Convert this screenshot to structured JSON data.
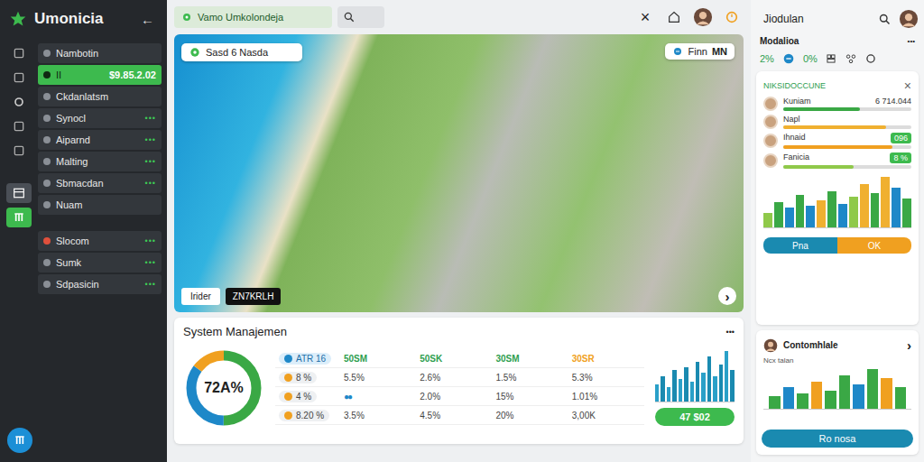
{
  "sidebar": {
    "logo": "Umonicia",
    "back": "←",
    "rail": [
      {
        "selected": false
      },
      {
        "selected": false
      },
      {
        "selected": false
      },
      {
        "selected": false
      },
      {
        "selected": false
      },
      {
        "selected": true
      },
      {
        "selected": false
      }
    ],
    "items": [
      {
        "label": "Nambotin",
        "value": "",
        "more": "",
        "selected": false
      },
      {
        "label": "II",
        "value": "$9.85.2.02",
        "more": "",
        "selected": true
      },
      {
        "label": "Ckdanlatsm",
        "value": "",
        "more": "",
        "selected": false
      },
      {
        "label": "Synocl",
        "value": "",
        "more": "•••",
        "selected": false
      },
      {
        "label": "Aiparnd",
        "value": "",
        "more": "•••",
        "selected": false
      },
      {
        "label": "Malting",
        "value": "",
        "more": "•••",
        "selected": false
      },
      {
        "label": "Sbmacdan",
        "value": "",
        "more": "•••",
        "selected": false
      },
      {
        "label": "Nuam",
        "value": "",
        "more": "",
        "selected": false
      }
    ],
    "items2": [
      {
        "label": "Slocom",
        "more": "•••"
      },
      {
        "label": "Sumk",
        "more": "•••"
      },
      {
        "label": "Sdpasicin",
        "more": "•••"
      }
    ]
  },
  "topbar": {
    "search": "Vamo Umkolondeja",
    "close": "×"
  },
  "map": {
    "location": "Sasd 6 Nasda",
    "toggle": "Finn",
    "toggle_value": "MN",
    "btn1": "Irider",
    "btn2": "ZN7KRLH",
    "next": "›"
  },
  "system": {
    "title": "System Manajemen",
    "more": "•••",
    "donut_label": "72A%",
    "donut": [
      {
        "level": 0.5,
        "color": "#3aa845"
      },
      {
        "level": 0.35,
        "color": "#1e88c8"
      },
      {
        "level": 0.15,
        "color": "#f0a020"
      }
    ],
    "columns": [
      {
        "label": "ATR 16",
        "color": "#1e88c8"
      },
      {
        "label": "50SM",
        "color": "#2e9e4f"
      },
      {
        "label": "50SK",
        "color": "#2e9e4f"
      },
      {
        "label": "30SM",
        "color": "#2e9e4f"
      },
      {
        "label": "30SR",
        "color": "#f0a020"
      }
    ],
    "rows": [
      {
        "color": "#f0a020",
        "cells": [
          "8 %",
          "5.5%",
          "2.6%",
          "1.5%",
          "5.3%"
        ]
      },
      {
        "color": "#f0a020",
        "cells": [
          "4 %",
          "●●",
          "2.0%",
          "15%",
          "1.01%"
        ]
      },
      {
        "color": "#f0a020",
        "cells": [
          "8.20 %",
          "3.5%",
          "4.5%",
          "20%",
          "3,00K"
        ]
      }
    ],
    "chart": [
      30,
      45,
      25,
      55,
      40,
      60,
      35,
      70,
      50,
      80,
      45,
      65,
      90,
      55
    ],
    "button": "47 $02"
  },
  "right": {
    "title": "Jiodulan",
    "section": "Modalioa",
    "more": "•••",
    "stat1": "2%",
    "stat2": "0%",
    "card_title": "NIKSIDOCCUNE",
    "close": "×",
    "people": [
      {
        "name": "Kuniam",
        "value": "6 714.044",
        "badge": "",
        "level": 0.6,
        "color": "#3aa845"
      },
      {
        "name": "Napl",
        "value": "",
        "badge": "",
        "level": 0.8,
        "color": "#f0b030"
      },
      {
        "name": "Ihnaid",
        "value": "",
        "badge": "096",
        "level": 0.85,
        "color": "#f0a020"
      },
      {
        "name": "Fanicia",
        "value": "",
        "badge": "8 %",
        "level": 0.55,
        "color": "#8fc94a"
      }
    ],
    "bars": [
      {
        "value": 20,
        "color": "#8fc94a"
      },
      {
        "value": 35,
        "color": "#3aa845"
      },
      {
        "value": 28,
        "color": "#1e88c8"
      },
      {
        "value": 45,
        "color": "#3aa845"
      },
      {
        "value": 30,
        "color": "#1e88c8"
      },
      {
        "value": 38,
        "color": "#f0b030"
      },
      {
        "value": 50,
        "color": "#3aa845"
      },
      {
        "value": 32,
        "color": "#1e88c8"
      },
      {
        "value": 42,
        "color": "#8fc94a"
      },
      {
        "value": 60,
        "color": "#f0b030"
      },
      {
        "value": 48,
        "color": "#3aa845"
      },
      {
        "value": 70,
        "color": "#f0b030"
      },
      {
        "value": 55,
        "color": "#1e88c8"
      },
      {
        "value": 40,
        "color": "#3aa845"
      }
    ],
    "btn1": "Pna",
    "btn2": "OK",
    "card2_title": "Contomhlale",
    "card2_arrow": "›",
    "card2_label": "Ncx talan",
    "card2_bars": [
      {
        "value": 20,
        "color": "#3aa845"
      },
      {
        "value": 35,
        "color": "#1e88c8"
      },
      {
        "value": 25,
        "color": "#3aa845"
      },
      {
        "value": 45,
        "color": "#f0a020"
      },
      {
        "value": 30,
        "color": "#3aa845"
      },
      {
        "value": 55,
        "color": "#3aa845"
      },
      {
        "value": 40,
        "color": "#1e88c8"
      },
      {
        "value": 65,
        "color": "#3aa845"
      },
      {
        "value": 50,
        "color": "#f0a020"
      },
      {
        "value": 35,
        "color": "#3aa845"
      }
    ],
    "card2_button": "Ro nosa"
  }
}
